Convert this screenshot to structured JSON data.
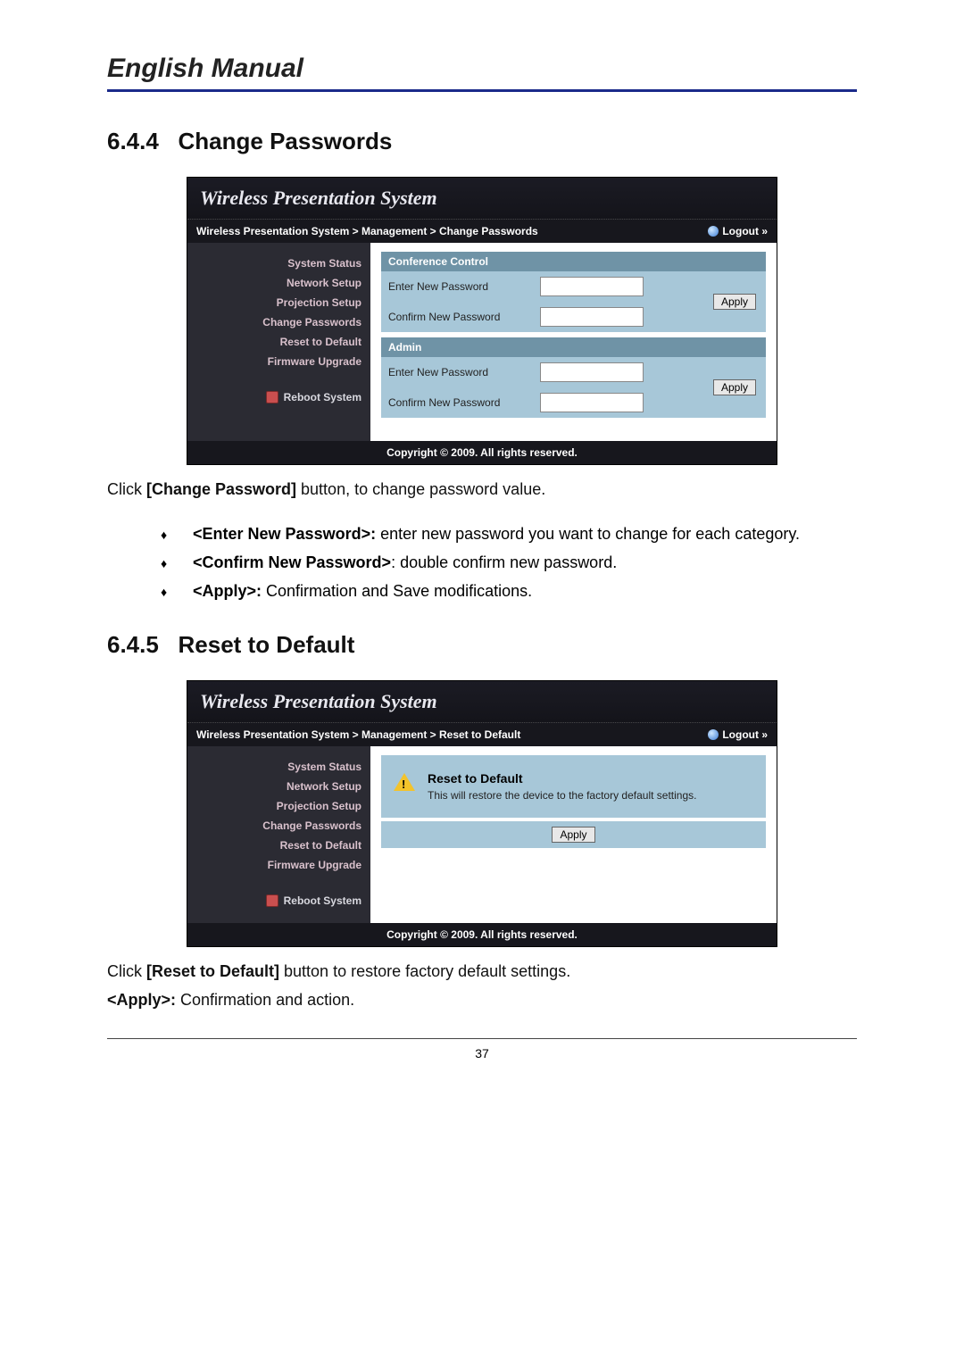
{
  "doc_header": "English Manual",
  "page_number": "37",
  "sections": {
    "s1": {
      "number": "6.4.4",
      "title": "Change Passwords"
    },
    "s2": {
      "number": "6.4.5",
      "title": "Reset to Default"
    }
  },
  "shared": {
    "system_title": "Wireless Presentation System",
    "logout_label": "Logout »",
    "copyright": "Copyright © 2009. All rights reserved.",
    "sidebar": {
      "items": [
        "System Status",
        "Network Setup",
        "Projection Setup",
        "Change Passwords",
        "Reset to Default",
        "Firmware Upgrade"
      ],
      "reboot": "Reboot System"
    }
  },
  "shot1": {
    "breadcrumb": "Wireless Presentation System > Management > Change Passwords",
    "panelA": {
      "title": "Conference Control",
      "row1": "Enter New Password",
      "row2": "Confirm New Password",
      "apply": "Apply"
    },
    "panelB": {
      "title": "Admin",
      "row1": "Enter New Password",
      "row2": "Confirm New Password",
      "apply": "Apply"
    }
  },
  "shot1_notes": {
    "intro_a": "Click ",
    "intro_b": "[Change Password]",
    "intro_c": " button, to change password value.",
    "bullets": [
      {
        "b": "<Enter New Password>:",
        "t": " enter new password you want to change for each category."
      },
      {
        "b": "<Confirm New Password>",
        "t": ": double confirm new password."
      },
      {
        "b": "<Apply>:",
        "t": " Confirmation and Save modifications."
      }
    ]
  },
  "shot2": {
    "breadcrumb": "Wireless Presentation System > Management > Reset to Default",
    "panel": {
      "title": "Reset to Default",
      "text": "This will restore the device to the factory default settings.",
      "apply": "Apply"
    }
  },
  "shot2_notes": {
    "line1_a": "Click ",
    "line1_b": "[Reset to Default]",
    "line1_c": " button to restore factory default settings.",
    "line2_b": "<Apply>:",
    "line2_t": " Confirmation and action."
  }
}
